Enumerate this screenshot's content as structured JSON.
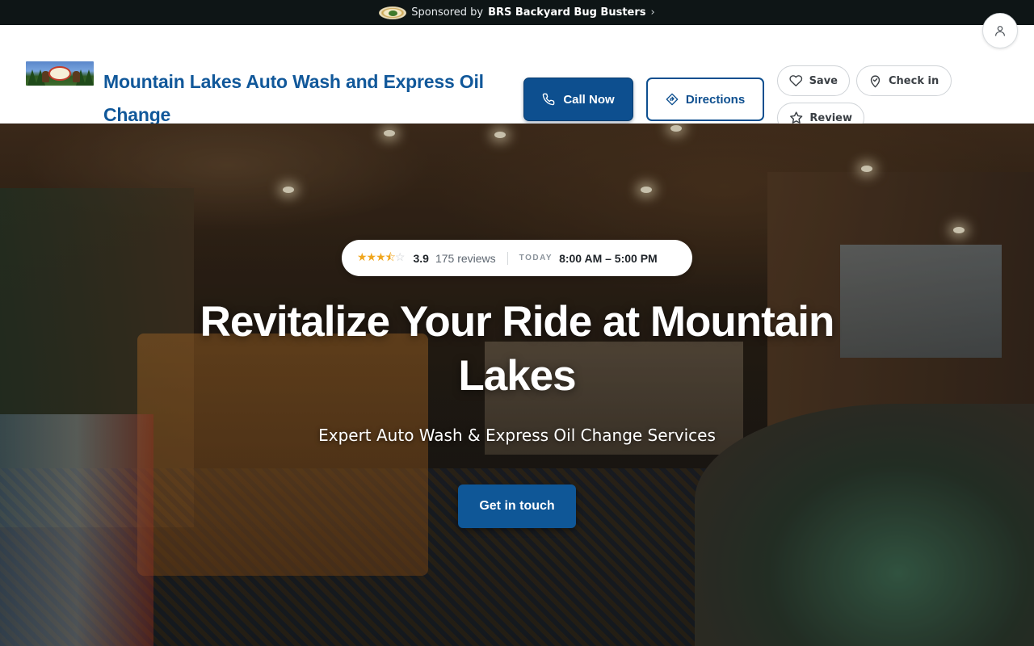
{
  "sponsor": {
    "prefix": "Sponsored by",
    "name": "BRS Backyard Bug Busters",
    "chevron": "›"
  },
  "header": {
    "business_name": "Mountain Lakes Auto Wash and Express Oil Change",
    "logo_icon": "business-logo",
    "call_label": "Call Now",
    "directions_label": "Directions",
    "save_label": "Save",
    "checkin_label": "Check in",
    "review_label": "Review",
    "account_icon": "user-icon"
  },
  "status": {
    "rating_value": 3.9,
    "rating_display": "3.9",
    "stars_filled": "★★★",
    "stars_half": "⯪",
    "stars_empty": "☆",
    "reviews": "175 reviews",
    "today_label": "TODAY",
    "hours": "8:00 AM – 5:00 PM"
  },
  "hero": {
    "title": "Revitalize Your Ride at Mountain Lakes",
    "subtitle": "Expert Auto Wash & Express Oil Change Services",
    "cta_label": "Get in touch"
  },
  "colors": {
    "brand_blue": "#0d4f8f",
    "title_blue": "#11589a",
    "star": "#f0a61e",
    "sponsor_bg": "#0e1516"
  }
}
